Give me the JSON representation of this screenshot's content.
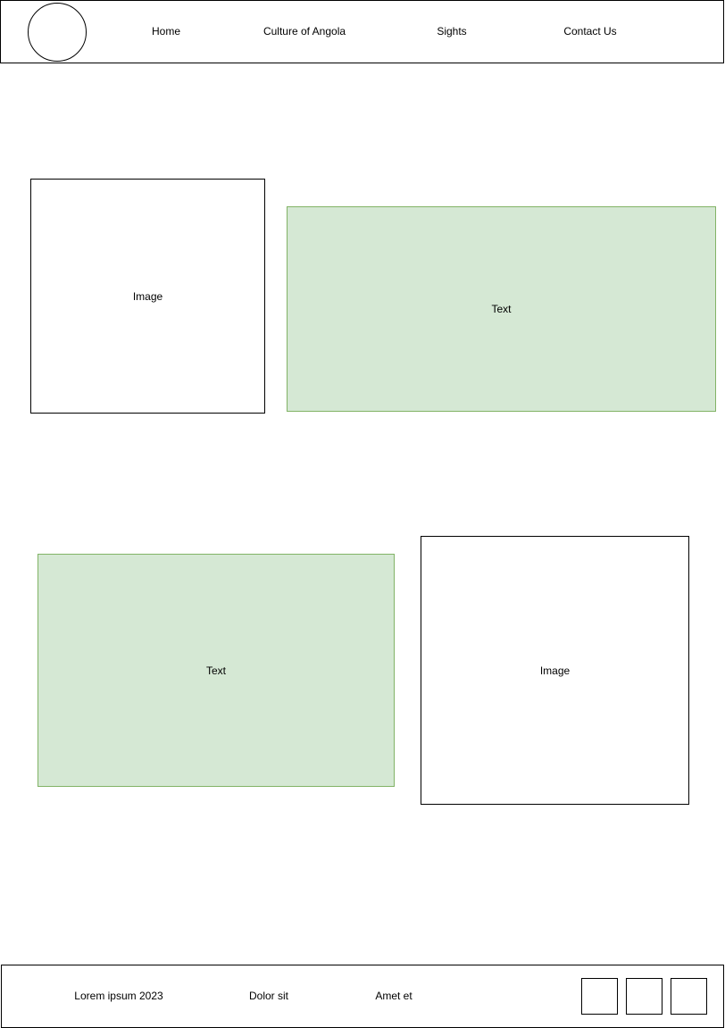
{
  "header": {
    "nav": {
      "home": "Home",
      "culture": "Culture of Angola",
      "sights": "Sights",
      "contact": "Contact Us"
    }
  },
  "main": {
    "section1": {
      "image_label": "Image",
      "text_label": "Text"
    },
    "section2": {
      "text_label": "Text",
      "image_label": "Image"
    }
  },
  "footer": {
    "copyright": "Lorem ipsum 2023",
    "link1": "Dolor sit",
    "link2": "Amet et"
  },
  "colors": {
    "text_block_fill": "#d5e8d4",
    "text_block_border": "#82b366",
    "outline": "#000000"
  }
}
